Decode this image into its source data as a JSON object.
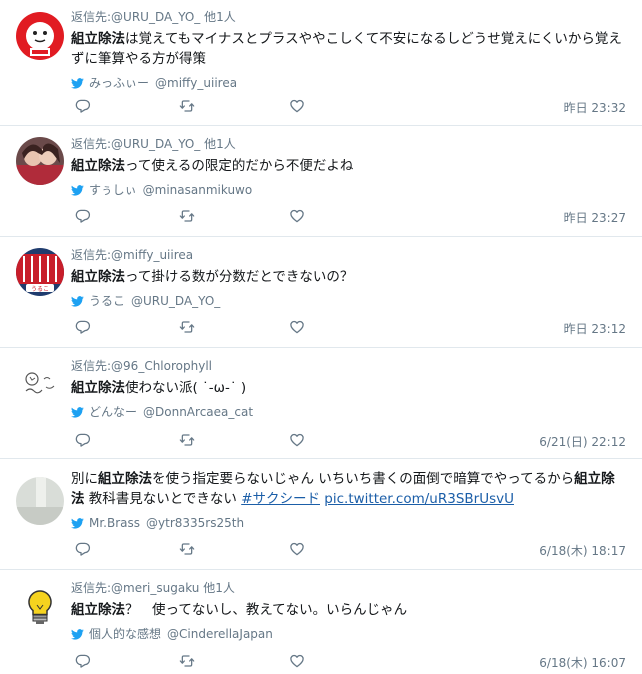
{
  "tweets": [
    {
      "reply_prefix": "返信先:",
      "reply_handle": "@URU_DA_YO_",
      "reply_extra": "他1人",
      "body_bold": "組立除法",
      "body_text": "は覚えてもマイナスとプラスややこしくて不安になるしどうせ覚えにくいから覚えずに筆算やる方が得策",
      "via_name": "みっふぃー",
      "via_handle": "@miffy_uiirea",
      "time": "昨日 23:32",
      "avatar": "red-character-avatar"
    },
    {
      "reply_prefix": "返信先:",
      "reply_handle": "@URU_DA_YO_",
      "reply_extra": "他1人",
      "body_bold": "組立除法",
      "body_text": "って使えるの限定的だから不便だよね",
      "via_name": "すぅしぃ",
      "via_handle": "@minasanmikuwo",
      "time": "昨日 23:27",
      "avatar": "photo-avatar"
    },
    {
      "reply_prefix": "返信先:",
      "reply_handle": "@miffy_uiirea",
      "reply_extra": "",
      "body_bold": "組立除法",
      "body_text": "って掛ける数が分数だとできないの？",
      "via_name": "うるこ",
      "via_handle": "@URU_DA_YO_",
      "time": "昨日 23:12",
      "avatar": "red-pattern-avatar"
    },
    {
      "reply_prefix": "返信先:",
      "reply_handle": "@96_Chlorophyll",
      "reply_extra": "",
      "body_bold": "組立除法",
      "body_text": "使わない派( ˙-ω-˙ )",
      "via_name": "どんなー",
      "via_handle": "@DonnArcaea_cat",
      "time": "6/21(日) 22:12",
      "avatar": "doodle-avatar"
    },
    {
      "body_pre": "別に",
      "body_bold": "組立除法",
      "body_mid": "を使う指定要らないじゃん いちいち書くの面倒で暗算でやってるから",
      "body_bold2": "組立除法",
      "body_post": " 教科書見ないとできない ",
      "hashtag": "#サクシード",
      "link": "pic.twitter.com/uR3SBrUsvU",
      "via_name": "Mr.Brass",
      "via_handle": "@ytr8335rs25th",
      "time": "6/18(木) 18:17",
      "avatar": "grey-avatar"
    },
    {
      "reply_prefix": "返信先:",
      "reply_handle": "@meri_sugaku",
      "reply_extra": "他1人",
      "body_bold": "組立除法",
      "body_text": "？　使ってないし、教えてない。いらんじゃん",
      "via_name": "個人的な感想",
      "via_handle": "@CinderellaJapan",
      "time": "6/18(木) 16:07",
      "avatar": "lightbulb-avatar"
    }
  ],
  "colors": {
    "text": "#14171a",
    "secondary": "#657786",
    "twitter_blue": "#1da1f2",
    "link": "#1b5ea8",
    "divider": "#e1e8ed"
  }
}
